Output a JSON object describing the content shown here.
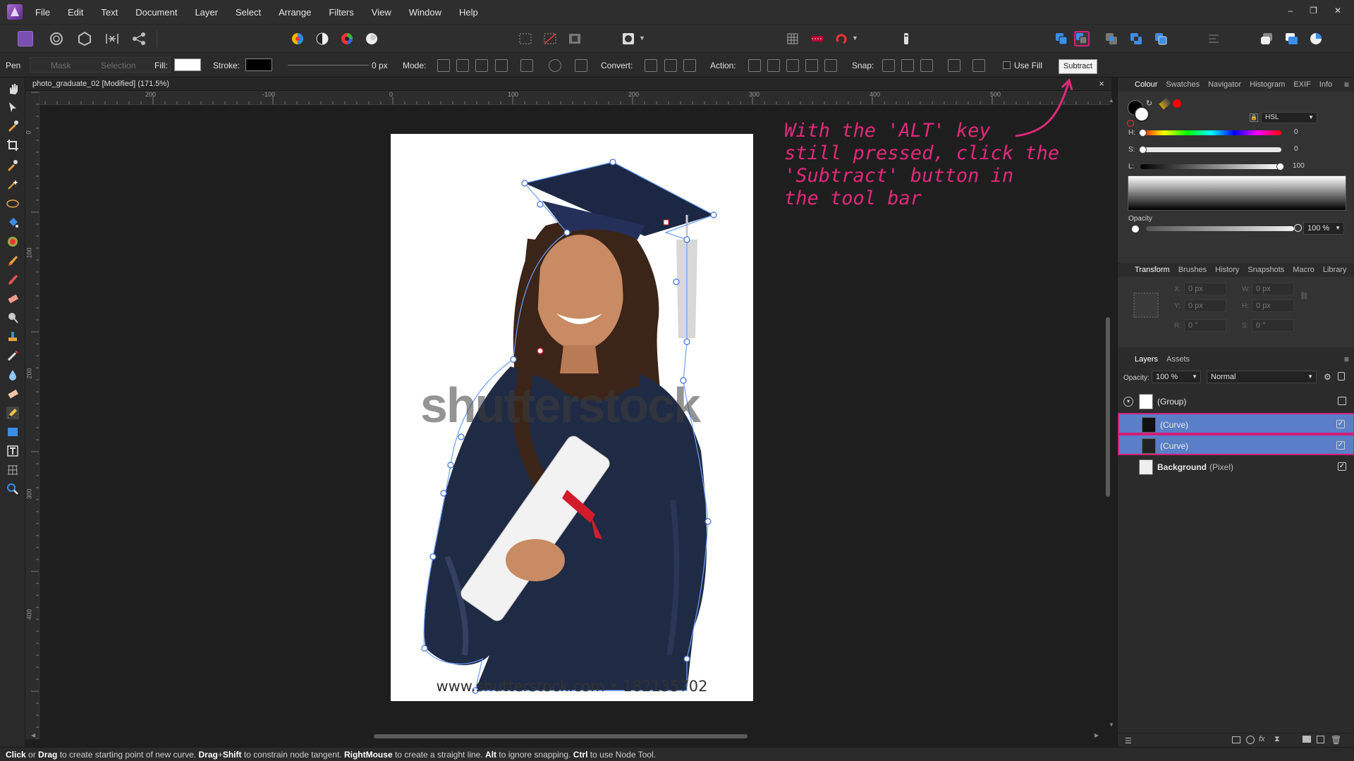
{
  "menu": [
    "File",
    "Edit",
    "Text",
    "Document",
    "Layer",
    "Select",
    "Arrange",
    "Filters",
    "View",
    "Window",
    "Help"
  ],
  "window_controls": [
    "–",
    "❐",
    "✕"
  ],
  "context": {
    "tool_name": "Pen",
    "mask": "Mask",
    "selection": "Selection",
    "fill": "Fill:",
    "stroke": "Stroke:",
    "stroke_width": "0 px",
    "mode": "Mode:",
    "convert": "Convert:",
    "action": "Action:",
    "snap": "Snap:",
    "use_fill": "Use Fill"
  },
  "tooltip": "Subtract",
  "document": {
    "title": "photo_graduate_02 [Modified] (171.5%)",
    "close": "×",
    "ruler_unit": "px",
    "h_ticks": [
      "200",
      "-100",
      "0",
      "100",
      "200",
      "300",
      "400",
      "500"
    ],
    "v_ticks": [
      "0",
      "100",
      "200",
      "300",
      "400"
    ],
    "watermark": "shutterstock",
    "photo_url": "www.shutterstock.com • 182135702"
  },
  "annotation": {
    "lines": [
      "With the 'ALT' key",
      "still pressed, click the",
      "'Subtract' button in",
      "the tool bar"
    ],
    "color": "#e0297a"
  },
  "colour_panel": {
    "tabs": [
      "Colour",
      "Swatches",
      "Navigator",
      "Histogram",
      "EXIF",
      "Info"
    ],
    "model": "HSL",
    "h_label": "H:",
    "h_value": "0",
    "s_label": "S:",
    "s_value": "0",
    "l_label": "L:",
    "l_value": "100",
    "opacity_label": "Opacity",
    "opacity_value": "100 %"
  },
  "transform_panel": {
    "tabs": [
      "Transform",
      "Brushes",
      "History",
      "Snapshots",
      "Macro",
      "Library"
    ],
    "x_label": "X:",
    "x": "0 px",
    "y_label": "Y:",
    "y": "0 px",
    "w_label": "W:",
    "w": "0 px",
    "h_label": "H:",
    "h": "0 px",
    "r_label": "R:",
    "r": "0 °",
    "s_label": "S:",
    "s": "0 °"
  },
  "layers_panel": {
    "tabs": [
      "Layers",
      "Assets"
    ],
    "opacity_label": "Opacity:",
    "opacity_value": "100 %",
    "blend_mode": "Normal",
    "layers": [
      {
        "name": "(Group)",
        "selected": false,
        "checked": false
      },
      {
        "name": "(Curve)",
        "selected": true,
        "checked": true
      },
      {
        "name": "(Curve)",
        "selected": true,
        "checked": true
      },
      {
        "name": "Background",
        "kind": "(Pixel)",
        "selected": false,
        "checked": true
      }
    ]
  },
  "status": {
    "parts": [
      {
        "b": "Click"
      },
      {
        "t": " or "
      },
      {
        "b": "Drag"
      },
      {
        "t": " to create starting point of new curve. "
      },
      {
        "b": "Drag"
      },
      {
        "t": "+"
      },
      {
        "b": "Shift"
      },
      {
        "t": " to constrain node tangent. "
      },
      {
        "b": "RightMouse"
      },
      {
        "t": " to create a straight line. "
      },
      {
        "b": "Alt"
      },
      {
        "t": " to ignore snapping. "
      },
      {
        "b": "Ctrl"
      },
      {
        "t": " to use Node Tool."
      }
    ]
  },
  "colors": {
    "highlight": "#d0207a",
    "layer_selected": "#5a7fc8",
    "accent_blue": "#3a8ee6"
  }
}
